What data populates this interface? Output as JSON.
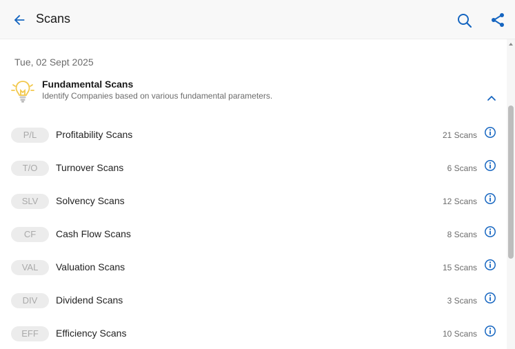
{
  "header": {
    "title": "Scans",
    "back_icon": "arrow-left-icon",
    "search_icon": "search-icon",
    "share_icon": "share-icon"
  },
  "content": {
    "date": "Tue, 02 Sept 2025",
    "section": {
      "title": "Fundamental Scans",
      "subtitle": "Identify Companies based on various fundamental parameters.",
      "icon": "lightbulb-icon",
      "expanded": true
    },
    "items": [
      {
        "badge": "P/L",
        "label": "Profitability Scans",
        "count": "21 Scans"
      },
      {
        "badge": "T/O",
        "label": "Turnover Scans",
        "count": "6 Scans"
      },
      {
        "badge": "SLV",
        "label": "Solvency Scans",
        "count": "12 Scans"
      },
      {
        "badge": "CF",
        "label": "Cash Flow Scans",
        "count": "8 Scans"
      },
      {
        "badge": "VAL",
        "label": "Valuation Scans",
        "count": "15 Scans"
      },
      {
        "badge": "DIV",
        "label": "Dividend Scans",
        "count": "3 Scans"
      },
      {
        "badge": "EFF",
        "label": "Efficiency Scans",
        "count": "10 Scans"
      }
    ]
  },
  "colors": {
    "accent": "#1565c0",
    "bulb": "#f2c84b",
    "badge_bg": "#ececec",
    "badge_text": "#a9a9a9"
  }
}
